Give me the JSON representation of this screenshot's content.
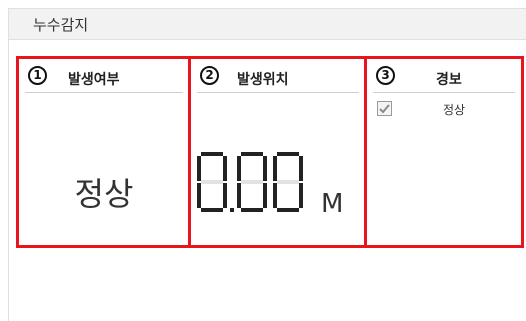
{
  "window": {
    "title": "누수감지"
  },
  "panels": [
    {
      "number": "1",
      "title": "발생여부",
      "value": "정상"
    },
    {
      "number": "2",
      "title": "발생위치",
      "value": "0.00",
      "unit": "M"
    },
    {
      "number": "3",
      "title": "경보",
      "alarm": {
        "label": "정상",
        "checked": true
      }
    }
  ],
  "colors": {
    "highlight": "#e8151b",
    "segment_on": "#222222",
    "segment_off": "#e2e2e2"
  }
}
